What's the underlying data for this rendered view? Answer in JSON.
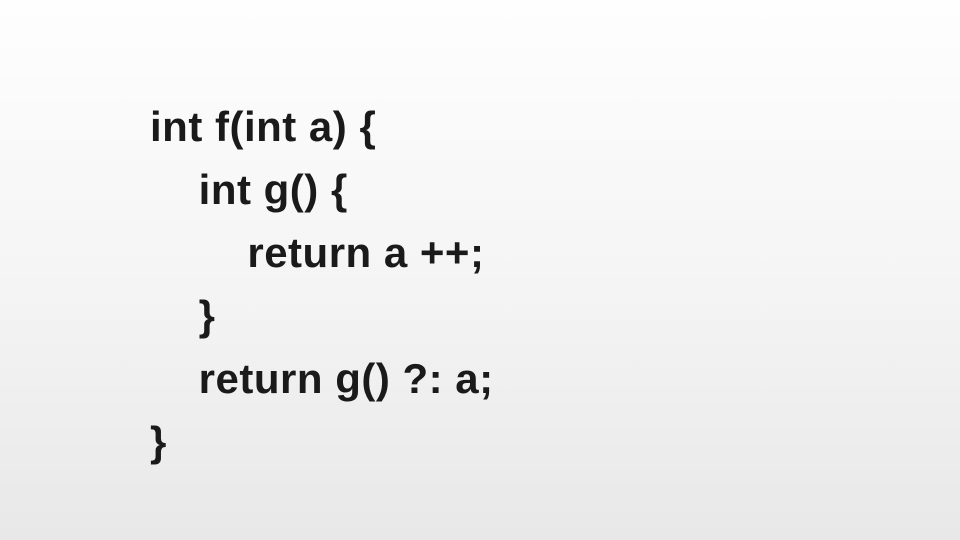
{
  "code": {
    "lines": [
      "int f(int a) {",
      "    int g() {",
      "        return a ++;",
      "    }",
      "    return g() ?: a;",
      "}"
    ]
  }
}
